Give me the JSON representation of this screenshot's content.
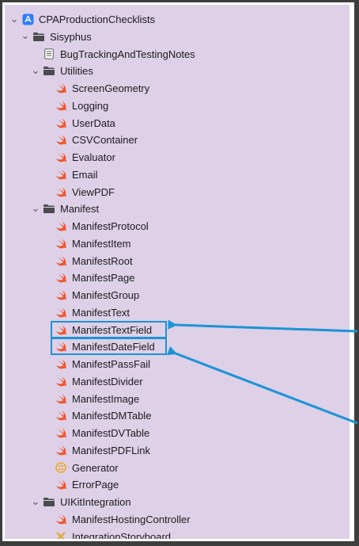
{
  "tree": [
    {
      "label": "CPAProductionChecklists",
      "icon": "project-icon",
      "depth": 0,
      "expanded": true
    },
    {
      "label": "Sisyphus",
      "icon": "folder-icon",
      "depth": 1,
      "expanded": true
    },
    {
      "label": "BugTrackingAndTestingNotes",
      "icon": "text-file-icon",
      "depth": 2
    },
    {
      "label": "Utilities",
      "icon": "folder-icon",
      "depth": 2,
      "expanded": true
    },
    {
      "label": "ScreenGeometry",
      "icon": "swift-icon",
      "depth": 3
    },
    {
      "label": "Logging",
      "icon": "swift-icon",
      "depth": 3
    },
    {
      "label": "UserData",
      "icon": "swift-icon",
      "depth": 3
    },
    {
      "label": "CSVContainer",
      "icon": "swift-icon",
      "depth": 3
    },
    {
      "label": "Evaluator",
      "icon": "swift-icon",
      "depth": 3
    },
    {
      "label": "Email",
      "icon": "swift-icon",
      "depth": 3
    },
    {
      "label": "ViewPDF",
      "icon": "swift-icon",
      "depth": 3
    },
    {
      "label": "Manifest",
      "icon": "folder-icon",
      "depth": 2,
      "expanded": true
    },
    {
      "label": "ManifestProtocol",
      "icon": "swift-icon",
      "depth": 3
    },
    {
      "label": "ManifestItem",
      "icon": "swift-icon",
      "depth": 3
    },
    {
      "label": "ManifestRoot",
      "icon": "swift-icon",
      "depth": 3
    },
    {
      "label": "ManifestPage",
      "icon": "swift-icon",
      "depth": 3
    },
    {
      "label": "ManifestGroup",
      "icon": "swift-icon",
      "depth": 3
    },
    {
      "label": "ManifestText",
      "icon": "swift-icon",
      "depth": 3
    },
    {
      "label": "ManifestTextField",
      "icon": "swift-icon",
      "depth": 3,
      "highlighted": true
    },
    {
      "label": "ManifestDateField",
      "icon": "swift-icon",
      "depth": 3,
      "highlighted": true
    },
    {
      "label": "ManifestPassFail",
      "icon": "swift-icon",
      "depth": 3
    },
    {
      "label": "ManifestDivider",
      "icon": "swift-icon",
      "depth": 3
    },
    {
      "label": "ManifestImage",
      "icon": "swift-icon",
      "depth": 3
    },
    {
      "label": "ManifestDMTable",
      "icon": "swift-icon",
      "depth": 3
    },
    {
      "label": "ManifestDVTable",
      "icon": "swift-icon",
      "depth": 3
    },
    {
      "label": "ManifestPDFLink",
      "icon": "swift-icon",
      "depth": 3
    },
    {
      "label": "Generator",
      "icon": "swift-package-icon",
      "depth": 3
    },
    {
      "label": "ErrorPage",
      "icon": "swift-icon",
      "depth": 3
    },
    {
      "label": "UIKitIntegration",
      "icon": "folder-icon",
      "depth": 2,
      "expanded": true
    },
    {
      "label": "ManifestHostingController",
      "icon": "swift-icon",
      "depth": 3
    },
    {
      "label": "IntegrationStoryboard",
      "icon": "storyboard-icon",
      "depth": 3
    }
  ],
  "colors": {
    "background": "#ddd0e7",
    "swift": "#f0542b",
    "folder": "#4a4a4f",
    "highlight": "#1d93d6",
    "project": "#2f7cf6"
  }
}
